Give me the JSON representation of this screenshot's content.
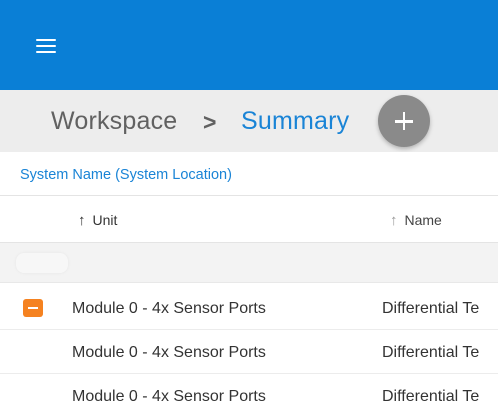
{
  "app_bar": {
    "menu_icon": "hamburger-menu-icon",
    "color": "#0a7fd6"
  },
  "breadcrumb": {
    "root": "Workspace",
    "separator": ">",
    "current": "Summary",
    "add_icon": "plus-icon"
  },
  "group_header": {
    "label": "System Name (System Location)"
  },
  "columns": {
    "unit": {
      "label": "Unit",
      "sort_icon": "arrow-up-icon"
    },
    "name": {
      "label": "Name",
      "sort_icon": "arrow-up-icon"
    }
  },
  "rows": [
    {
      "unit": "Module 0 - 4x Sensor Ports",
      "name": "Differential Te",
      "collapse_icon": "minus-square-icon"
    },
    {
      "unit": "Module 0 - 4x Sensor Ports",
      "name": "Differential Te"
    },
    {
      "unit": "Module 0 - 4x Sensor Ports",
      "name": "Differential Te"
    }
  ],
  "colors": {
    "accent": "#1a84d6",
    "collapse": "#f58220",
    "add_button": "#8a8a8a"
  }
}
